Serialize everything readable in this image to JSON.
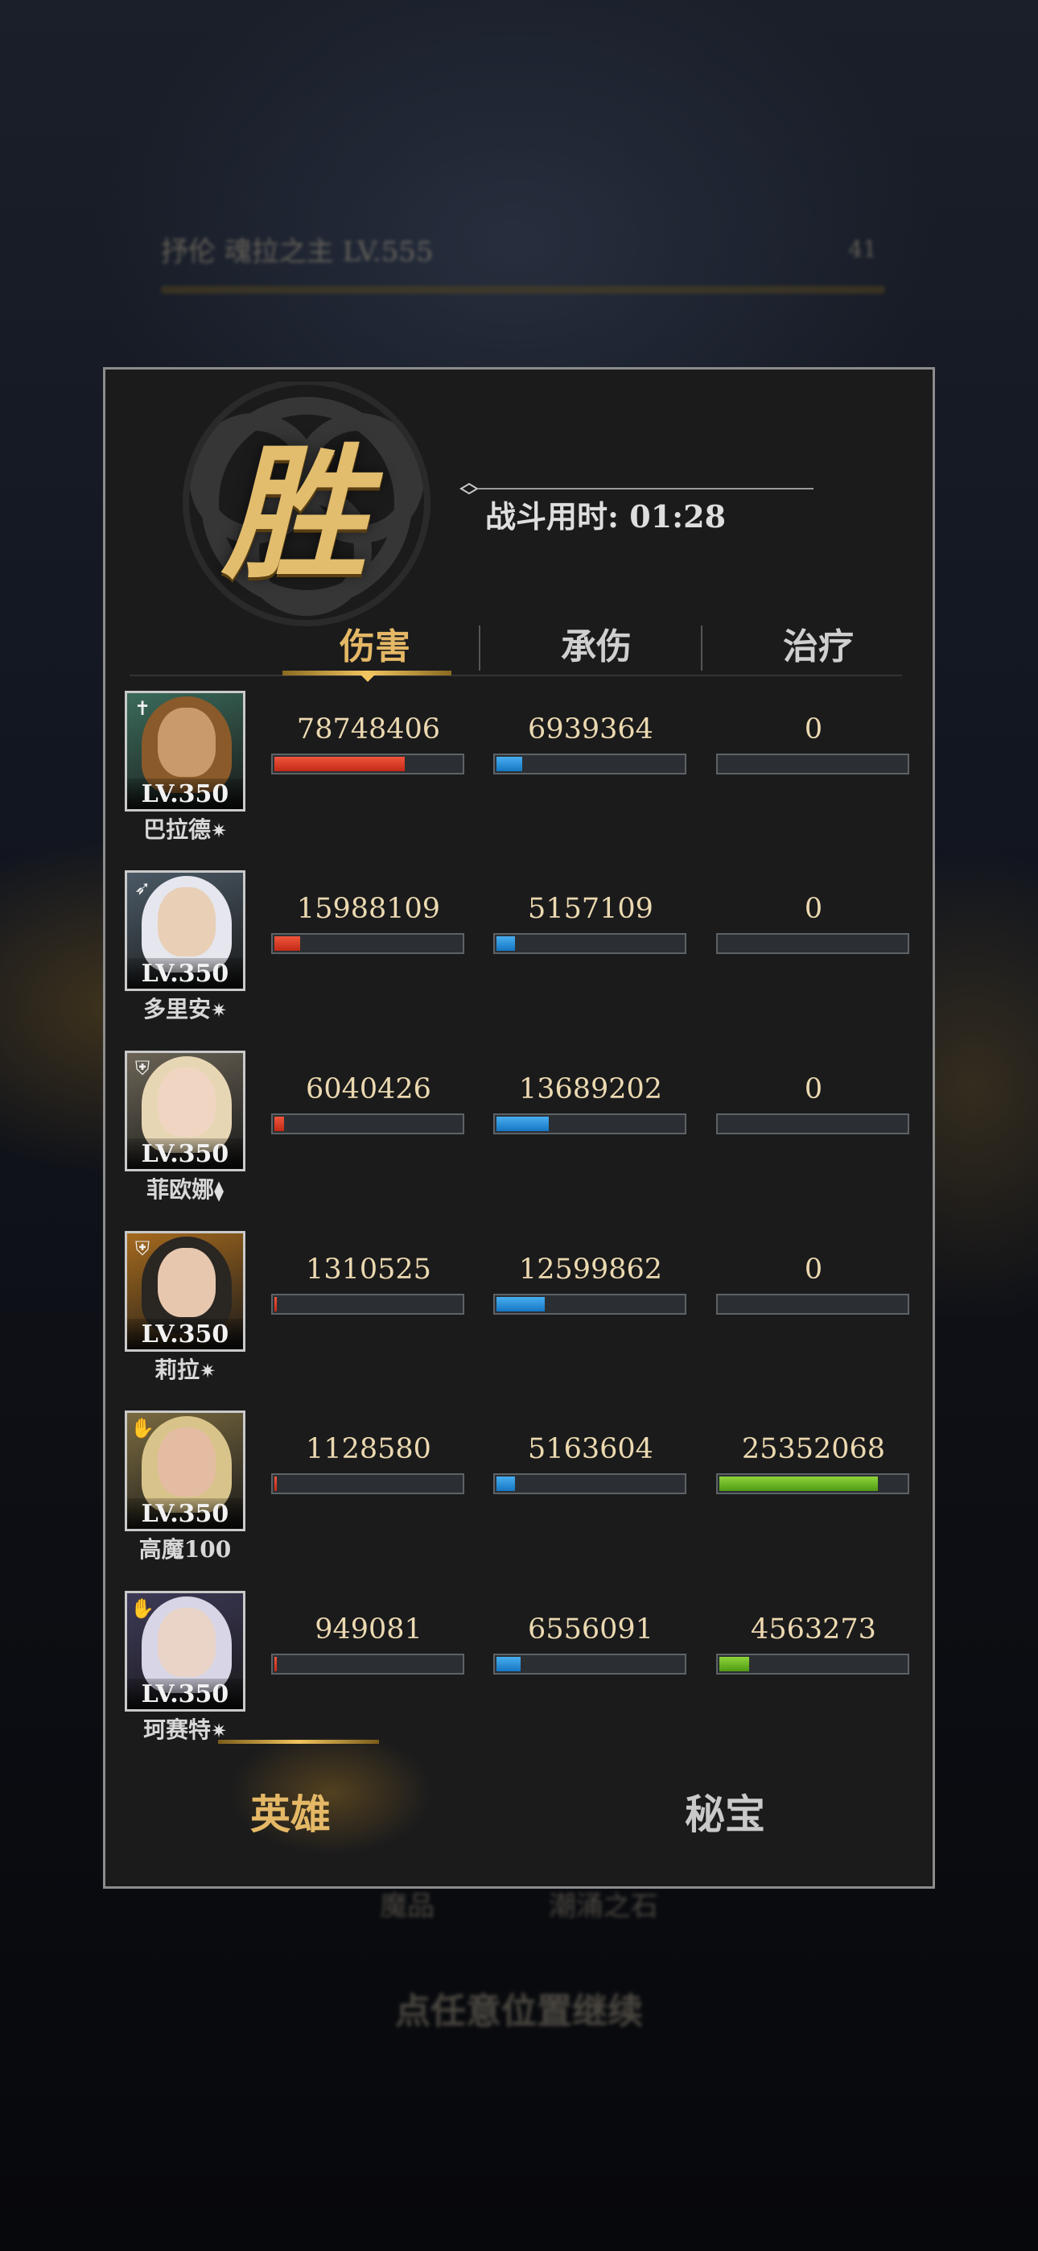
{
  "background": {
    "boss_bar_label": "抒伦 魂拉之主 LV.555",
    "boss_bar_count": "41",
    "bottom_labels": [
      "魔品",
      "潮涌之石"
    ],
    "continue_hint": "点任意位置继续"
  },
  "result": {
    "victory_text": "胜",
    "battle_time": "战斗用时: 01:28"
  },
  "tabs": [
    {
      "label": "伤害",
      "active": true
    },
    {
      "label": "承伤",
      "active": false
    },
    {
      "label": "治疗",
      "active": false
    }
  ],
  "heroes": [
    {
      "name": "巴拉德",
      "level": "LV.350",
      "class_icon": "sword-icon",
      "star": "✷",
      "damage": "78748406",
      "damage_ratio": 0.7,
      "taken": "6939364",
      "taken_ratio": 0.14,
      "heal": "0",
      "heal_ratio": 0.0
    },
    {
      "name": "多里安",
      "level": "LV.350",
      "class_icon": "bow-icon",
      "star": "✷",
      "damage": "15988109",
      "damage_ratio": 0.14,
      "taken": "5157109",
      "taken_ratio": 0.1,
      "heal": "0",
      "heal_ratio": 0.0
    },
    {
      "name": "菲欧娜",
      "level": "LV.350",
      "class_icon": "shield-icon",
      "star": "⧫",
      "damage": "6040426",
      "damage_ratio": 0.05,
      "taken": "13689202",
      "taken_ratio": 0.28,
      "heal": "0",
      "heal_ratio": 0.0
    },
    {
      "name": "莉拉",
      "level": "LV.350",
      "class_icon": "shield-icon",
      "star": "✷",
      "damage": "1310525",
      "damage_ratio": 0.01,
      "taken": "12599862",
      "taken_ratio": 0.26,
      "heal": "0",
      "heal_ratio": 0.0
    },
    {
      "name": "高魔100",
      "level": "LV.350",
      "class_icon": "hand-icon",
      "star": "",
      "damage": "1128580",
      "damage_ratio": 0.01,
      "taken": "5163604",
      "taken_ratio": 0.1,
      "heal": "25352068",
      "heal_ratio": 0.85
    },
    {
      "name": "珂赛特",
      "level": "LV.350",
      "class_icon": "hand-icon",
      "star": "✷",
      "damage": "949081",
      "damage_ratio": 0.01,
      "taken": "6556091",
      "taken_ratio": 0.13,
      "heal": "4563273",
      "heal_ratio": 0.16
    }
  ],
  "bottom_tabs": [
    {
      "label": "英雄",
      "active": true
    },
    {
      "label": "秘宝",
      "active": false
    }
  ],
  "colors": {
    "accent_gold": "#e4b866",
    "damage_bar": "#d8371f",
    "taken_bar": "#2a8fd8",
    "heal_bar": "#6cb829"
  },
  "portrait_palettes": [
    {
      "bg": "#3a6b5a",
      "hair": "#8a5a2a",
      "face": "#c99a6a"
    },
    {
      "bg": "#4b5a66",
      "hair": "#e6e6ee",
      "face": "#e8cfb6"
    },
    {
      "bg": "#6b6456",
      "hair": "#e7d6b4",
      "face": "#f0d6c2"
    },
    {
      "bg": "#a56a1e",
      "hair": "#2a2622",
      "face": "#e7c8ae"
    },
    {
      "bg": "#7a6a40",
      "hair": "#d8c48a",
      "face": "#e4bca2"
    },
    {
      "bg": "#3d3a58",
      "hair": "#d8d6e6",
      "face": "#ead4c8"
    }
  ]
}
